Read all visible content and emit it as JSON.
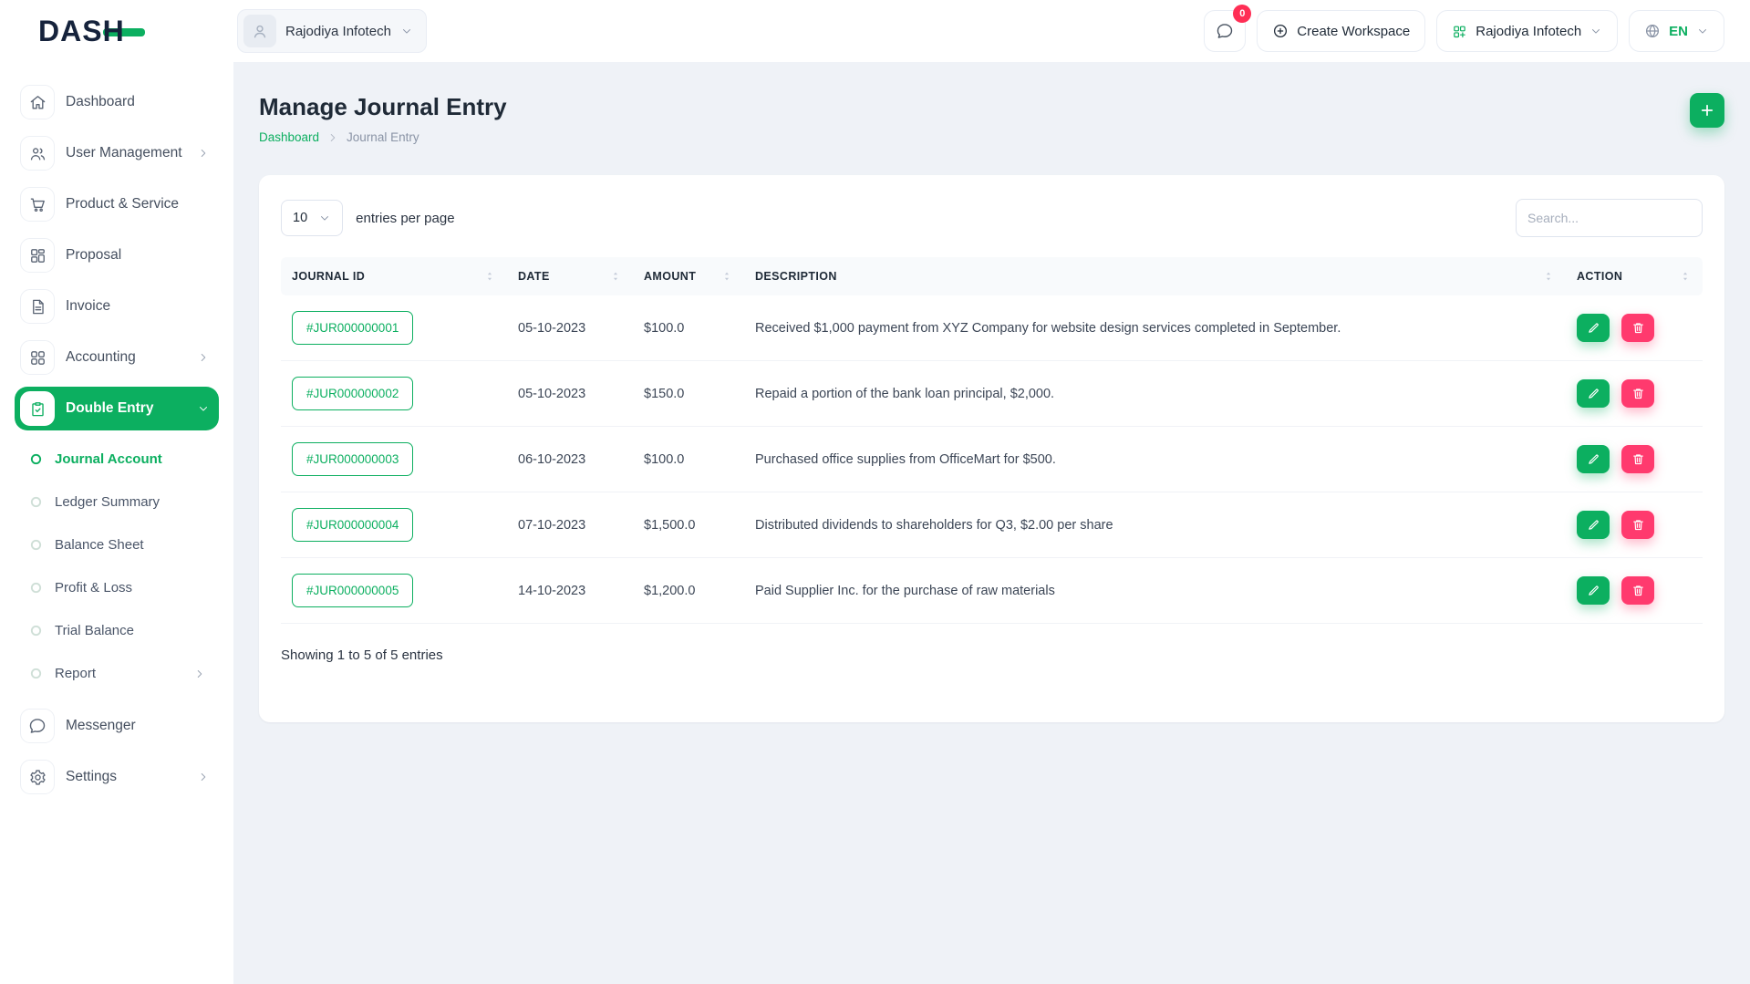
{
  "brand": {
    "name": "DASH"
  },
  "colors": {
    "primary": "#0caf60",
    "danger": "#ff3a6e",
    "badge": "#ff2e55",
    "dark": "#16233c"
  },
  "header": {
    "workspace": {
      "label": "Rajodiya Infotech",
      "avatar_icon": "user-icon",
      "chevron_icon": "chevron-down-icon"
    },
    "messages": {
      "icon": "chat-icon",
      "badge": "0"
    },
    "create_workspace": {
      "label": "Create Workspace",
      "icon": "plus-circle-icon"
    },
    "company_menu": {
      "label": "Rajodiya Infotech",
      "icon": "workspace-icon",
      "chevron_icon": "chevron-down-icon"
    },
    "language": {
      "label": "EN",
      "icon": "globe-icon",
      "chevron_icon": "chevron-down-icon"
    }
  },
  "sidebar": {
    "bullet_icon": "circle-icon",
    "items": [
      {
        "label": "Dashboard",
        "icon": "home-icon"
      },
      {
        "label": "User Management",
        "icon": "users-icon",
        "has_children": true
      },
      {
        "label": "Product & Service",
        "icon": "cart-icon"
      },
      {
        "label": "Proposal",
        "icon": "layout-icon"
      },
      {
        "label": "Invoice",
        "icon": "invoice-icon"
      },
      {
        "label": "Accounting",
        "icon": "blocks-icon",
        "has_children": true
      },
      {
        "label": "Double Entry",
        "icon": "journal-icon",
        "active": true,
        "expanded": true,
        "children": [
          {
            "label": "Journal Account",
            "active": true
          },
          {
            "label": "Ledger Summary"
          },
          {
            "label": "Balance Sheet"
          },
          {
            "label": "Profit & Loss"
          },
          {
            "label": "Trial Balance"
          },
          {
            "label": "Report",
            "has_children": true
          }
        ]
      },
      {
        "label": "Messenger",
        "icon": "chat-icon"
      },
      {
        "label": "Settings",
        "icon": "gear-icon",
        "has_children": true
      }
    ]
  },
  "page": {
    "title": "Manage Journal Entry",
    "breadcrumb": {
      "root": "Dashboard",
      "current": "Journal Entry",
      "separator_icon": "chevron-right-icon"
    },
    "add_button_icon": "plus-icon"
  },
  "table": {
    "entries_select": "10",
    "select_chevron_icon": "chevron-down-icon",
    "entries_label": "entries per page",
    "search_placeholder": "Search...",
    "sort_icon": "sort-icon",
    "edit_icon": "pencil-icon",
    "delete_icon": "trash-icon",
    "columns": [
      "JOURNAL ID",
      "DATE",
      "AMOUNT",
      "DESCRIPTION",
      "ACTION"
    ],
    "rows": [
      {
        "journal_id": "#JUR000000001",
        "date": "05-10-2023",
        "amount": "$100.0",
        "description": "Received $1,000 payment from XYZ Company for website design services completed in September."
      },
      {
        "journal_id": "#JUR000000002",
        "date": "05-10-2023",
        "amount": "$150.0",
        "description": "Repaid a portion of the bank loan principal, $2,000."
      },
      {
        "journal_id": "#JUR000000003",
        "date": "06-10-2023",
        "amount": "$100.0",
        "description": "Purchased office supplies from OfficeMart for $500."
      },
      {
        "journal_id": "#JUR000000004",
        "date": "07-10-2023",
        "amount": "$1,500.0",
        "description": "Distributed dividends to shareholders for Q3, $2.00 per share"
      },
      {
        "journal_id": "#JUR000000005",
        "date": "14-10-2023",
        "amount": "$1,200.0",
        "description": "Paid Supplier Inc. for the purchase of raw materials"
      }
    ],
    "footer": "Showing 1 to 5 of 5 entries"
  }
}
